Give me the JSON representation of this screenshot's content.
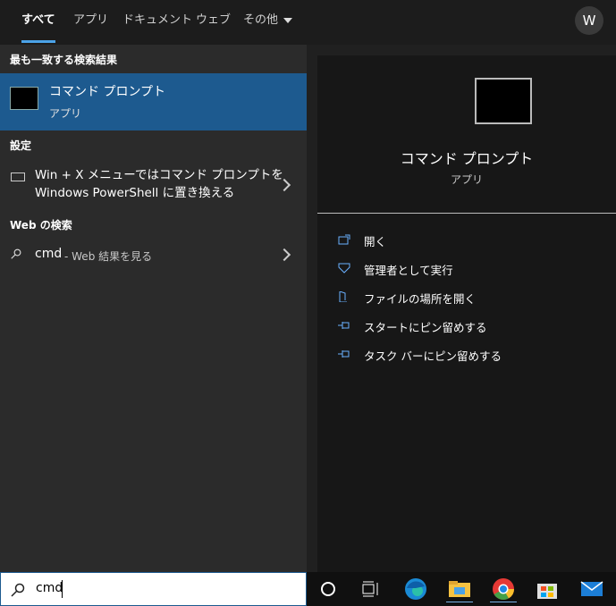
{
  "tabs": [
    {
      "label": "すべて",
      "active": true
    },
    {
      "label": "アプリ"
    },
    {
      "label": "ドキュメント"
    },
    {
      "label": "ウェブ"
    },
    {
      "label": "その他"
    }
  ],
  "avatar": "W",
  "left": {
    "best_match_heading": "最も一致する検索結果",
    "best_match": {
      "name": "コマンド プロンプト",
      "type": "アプリ"
    },
    "settings_heading": "設定",
    "settings_item_line1": "Win + X メニューではコマンド プロンプトを",
    "settings_item_line2": "Windows PowerShell に置き換える",
    "web_heading": "Web の検索",
    "web_query": "cmd",
    "web_suffix": "- Web 結果を見る"
  },
  "right": {
    "name": "コマンド プロンプト",
    "type": "アプリ",
    "actions": [
      {
        "label": "開く",
        "icon": "open-icon"
      },
      {
        "label": "管理者として実行",
        "icon": "shield-icon"
      },
      {
        "label": "ファイルの場所を開く",
        "icon": "file-location-icon"
      },
      {
        "label": "スタートにピン留めする",
        "icon": "pin-icon"
      },
      {
        "label": "タスク バーにピン留めする",
        "icon": "pin-icon"
      }
    ]
  },
  "search": {
    "value": "cmd"
  },
  "taskbar_icons": [
    "cortana-icon",
    "task-view-icon",
    "edge-icon",
    "file-explorer-icon",
    "chrome-icon",
    "store-icon",
    "mail-icon"
  ],
  "colors": {
    "accent": "#1d5a8f",
    "tab_underline": "#4ba3e8"
  }
}
